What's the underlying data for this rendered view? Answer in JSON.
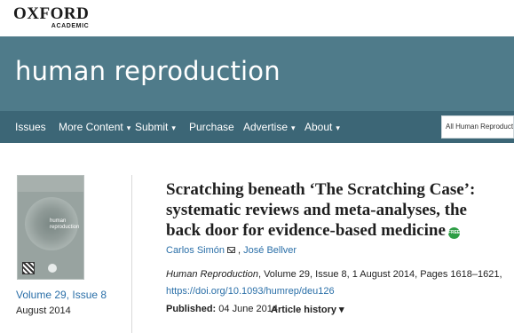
{
  "publisher": {
    "logo_main": "OXFORD",
    "logo_sub": "ACADEMIC"
  },
  "journal": {
    "title": "human reproduction"
  },
  "nav": {
    "items": [
      {
        "label": "Issues",
        "has_caret": false
      },
      {
        "label": "More Content",
        "has_caret": true
      },
      {
        "label": "Submit",
        "has_caret": true
      },
      {
        "label": "Purchase",
        "has_caret": false
      },
      {
        "label": "Advertise",
        "has_caret": true
      },
      {
        "label": "About",
        "has_caret": true
      }
    ],
    "caret": "▾",
    "search_scope": "All Human Reproduction"
  },
  "issue": {
    "cover_label": "human reproduction",
    "volume_link": "Volume 29, Issue 8",
    "date": "August 2014"
  },
  "article": {
    "title": "Scratching beneath ‘The Scratching Case’: systematic reviews and meta-analyses, the back door for evidence-based medicine",
    "free_badge": "FREE",
    "authors": [
      "Carlos Simón",
      "José Bellver"
    ],
    "author_separator": ",",
    "citation_journal": "Human Reproduction",
    "citation_details": ", Volume 29, Issue 8, 1 August 2014, Pages 1618–1621,",
    "doi": "https://doi.org/10.1093/humrep/deu126",
    "published_label": "Published:",
    "published_date": "04 June 2014",
    "history_label": "Article history",
    "history_caret": "▾"
  },
  "colors": {
    "banner": "#4f7b8a",
    "nav": "#3c6676",
    "link": "#2a6fa8",
    "free_badge": "#2e9e45"
  }
}
